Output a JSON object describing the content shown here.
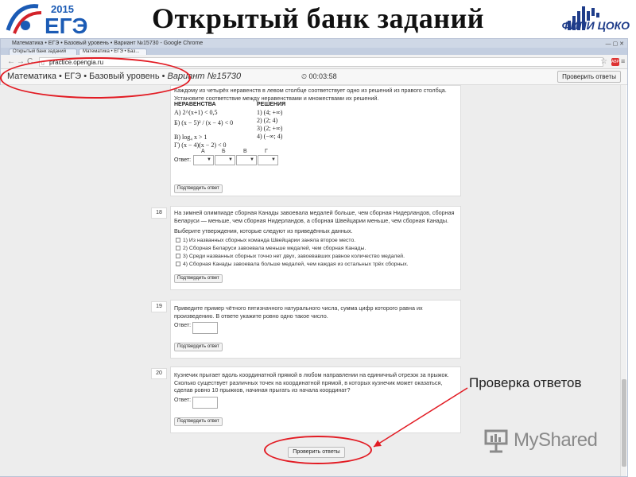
{
  "slide": {
    "title": "Открытый банк заданий",
    "ege_logo": {
      "year": "2015",
      "text": "ЕГЭ"
    },
    "fipi_logo": "ФИПИ ЦОКО",
    "callout": "Проверка ответов"
  },
  "browser": {
    "window_title": "Математика • ЕГЭ • Базовый уровень • Вариант №15730 - Google Chrome",
    "tabs": [
      {
        "label": "Открытый банк заданий"
      },
      {
        "label": "Математика • ЕГЭ • Баз..."
      }
    ],
    "url": "practice.opengia.ru",
    "ext_label": "ABP"
  },
  "site": {
    "breadcrumb": "Математика • ЕГЭ • Базовый уровень •",
    "variant": "Вариант №15730",
    "timer": "00:03:58",
    "check_button": "Проверить ответы"
  },
  "task17": {
    "intro": "Каждому из четырёх неравенств в левом столбце соответствует одно из решений из правого столбца. Установите соответствие между неравенствами и множествами их решений.",
    "col_left": "НЕРАВЕНСТВА",
    "col_right": "РЕШЕНИЯ",
    "inequalities": [
      {
        "label": "А)",
        "expr": "2^(x+1) < 0,5"
      },
      {
        "label": "Б)",
        "expr": "(x − 5)² / (x − 4) < 0"
      },
      {
        "label": "В)",
        "expr": "log₄ x > 1"
      },
      {
        "label": "Г)",
        "expr": "(x − 4)(x − 2) < 0"
      }
    ],
    "solutions": [
      {
        "label": "1)",
        "expr": "(4; +∞)"
      },
      {
        "label": "2)",
        "expr": "(2; 4)"
      },
      {
        "label": "3)",
        "expr": "(2; +∞)"
      },
      {
        "label": "4)",
        "expr": "(−∞; 4)"
      }
    ],
    "answer_label": "Ответ:",
    "letters": [
      "А",
      "Б",
      "В",
      "Г"
    ],
    "confirm": "Подтвердить ответ"
  },
  "task18": {
    "number": "18",
    "text": "На зимней олимпиаде сборная Канады завоевала медалей больше, чем сборная Нидерландов, сборная Беларуси — меньше, чем сборная Нидерландов, а сборная Швейцарии меньше, чем сборная Канады.",
    "prompt": "Выберите утверждения, которые следуют из приведённых данных.",
    "options": [
      "1) Из названных сборных команда Швейцарии заняла второе место.",
      "2) Сборная Беларуси завоевала меньше медалей, чем сборная Канады.",
      "3) Среди названных сборных точно нет двух, завоевавших равное количество медалей.",
      "4) Сборная Канады завоевала больше медалей, чем каждая из остальных трёх сборных."
    ],
    "confirm": "Подтвердить ответ"
  },
  "task19": {
    "number": "19",
    "text": "Приведите пример чётного пятизначного натурального числа, сумма цифр которого равна их произведению. В ответе укажите ровно одно такое число.",
    "answer_label": "Ответ:",
    "confirm": "Подтвердить ответ"
  },
  "task20": {
    "number": "20",
    "text": "Кузнечик прыгает вдоль координатной прямой в любом направлении на единичный отрезок за прыжок. Сколько существует различных точек на координатной прямой, в которых кузнечик может оказаться, сделав ровно 10 прыжков, начиная прыгать из начала координат?",
    "answer_label": "Ответ:",
    "confirm": "Подтвердить ответ"
  },
  "bottom": {
    "check_button": "Проверить ответы"
  },
  "watermark": "MyShared",
  "colors": {
    "annotation_red": "#e21b23",
    "title_black": "#111111",
    "fipi_blue": "#1f3d8a"
  }
}
